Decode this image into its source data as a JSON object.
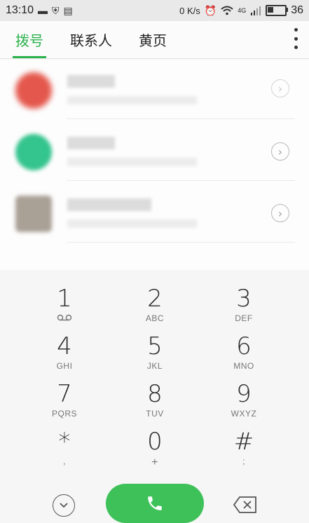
{
  "status": {
    "time": "13:10",
    "data_speed": "0 K/s",
    "network": "4G",
    "battery": "36"
  },
  "tabs": [
    {
      "label": "拨号",
      "active": true
    },
    {
      "label": "联系人",
      "active": false
    },
    {
      "label": "黄页",
      "active": false
    }
  ],
  "colors": {
    "accent": "#2bb24c",
    "call": "#3fc15a",
    "avatar_1": "#e4574c",
    "avatar_2": "#34c48e",
    "avatar_3": "#a9a096"
  },
  "recent_calls": [
    {
      "avatar_icon": "avatar-red-blurred"
    },
    {
      "avatar_icon": "avatar-green-blurred"
    },
    {
      "avatar_icon": "avatar-grey-blurred"
    }
  ],
  "dialpad": {
    "keys": [
      {
        "digit": "1",
        "letters": "voicemail-icon"
      },
      {
        "digit": "2",
        "letters": "ABC"
      },
      {
        "digit": "3",
        "letters": "DEF"
      },
      {
        "digit": "4",
        "letters": "GHI"
      },
      {
        "digit": "5",
        "letters": "JKL"
      },
      {
        "digit": "6",
        "letters": "MNO"
      },
      {
        "digit": "7",
        "letters": "PQRS"
      },
      {
        "digit": "8",
        "letters": "TUV"
      },
      {
        "digit": "9",
        "letters": "WXYZ"
      },
      {
        "digit": "*",
        "letters": ","
      },
      {
        "digit": "0",
        "letters": "+"
      },
      {
        "digit": "#",
        "letters": ";"
      }
    ]
  }
}
